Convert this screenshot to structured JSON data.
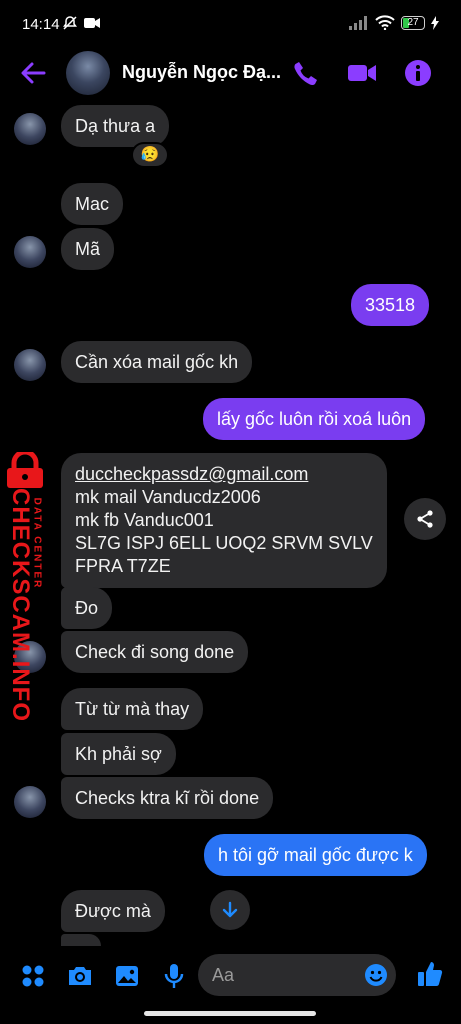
{
  "status_bar": {
    "time": "14:14",
    "battery": "27"
  },
  "header": {
    "contact_name": "Nguyễn Ngọc Đạ..."
  },
  "messages": [
    {
      "text": "Dạ thưa a",
      "sender": "them"
    },
    {
      "text": "😥",
      "type": "reaction"
    },
    {
      "text": "Mac",
      "sender": "them"
    },
    {
      "text": "Mã",
      "sender": "them"
    },
    {
      "text": "33518",
      "sender": "me"
    },
    {
      "text": "Cần xóa mail gốc kh",
      "sender": "them"
    },
    {
      "text": "lấy gốc luôn rồi xoá luôn",
      "sender": "me"
    },
    {
      "lines": [
        "duccheckpassdz@gmail.com",
        "mk mail Vanducdz2006",
        "mk fb Vanduc001",
        "SL7G ISPJ 6ELL UOQ2 SRVM SVLV",
        "FPRA T7ZE"
      ],
      "sender": "them"
    },
    {
      "text": "Đo",
      "sender": "them"
    },
    {
      "text": "Check đi song done",
      "sender": "them"
    },
    {
      "text": "Từ từ mà thay",
      "sender": "them"
    },
    {
      "text": "Kh phải sợ",
      "sender": "them"
    },
    {
      "text": "Checks ktra kĩ rồi done",
      "sender": "them"
    },
    {
      "text": "h tôi gỡ mail gốc được k",
      "sender": "me"
    },
    {
      "text": "Được mà",
      "sender": "them"
    }
  ],
  "watermark": {
    "main": "CHECKSCAM.INFO",
    "sub": "DATA CENTER"
  },
  "composer": {
    "placeholder": "Aa"
  },
  "colors": {
    "accent": "#8b3dff",
    "my_bubble": "#7a3df0",
    "my_bubble_blue": "#2a74f5",
    "their_bubble": "#2b2b2d",
    "action_blue": "#1f8bff"
  }
}
